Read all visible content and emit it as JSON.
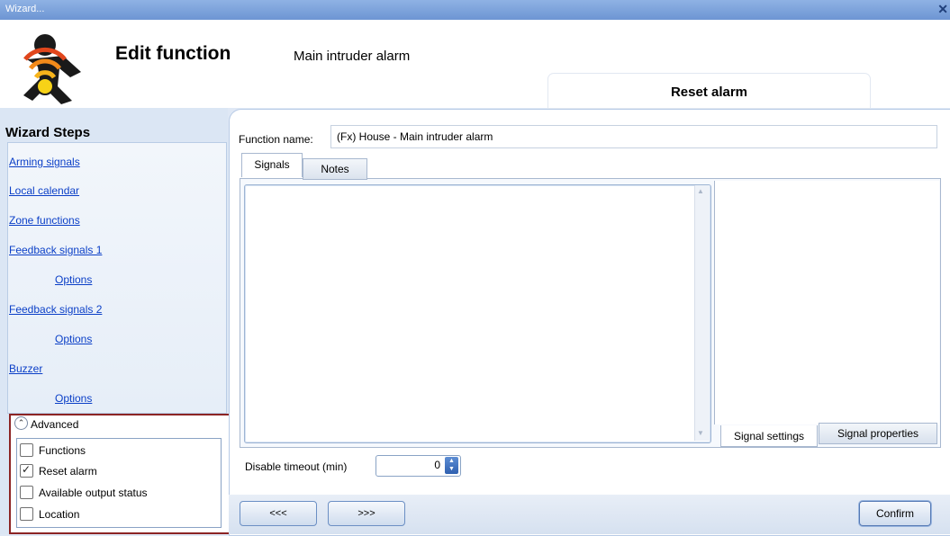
{
  "window": {
    "title": "Wizard...",
    "close_icon": "close-icon"
  },
  "header": {
    "title": "Edit function",
    "subtitle": "Main intruder alarm",
    "current_step": "Reset alarm"
  },
  "sidebar": {
    "title": "Wizard Steps",
    "steps": [
      {
        "label": "Arming signals"
      },
      {
        "label": "Local calendar"
      },
      {
        "label": "Zone functions"
      },
      {
        "label": "Feedback signals 1"
      },
      {
        "label": "Options"
      },
      {
        "label": "Feedback signals 2"
      },
      {
        "label": "Options"
      },
      {
        "label": "Buzzer"
      },
      {
        "label": "Options"
      }
    ],
    "advanced": {
      "label": "Advanced",
      "options": [
        {
          "label": "Functions",
          "checked": false
        },
        {
          "label": "Reset alarm",
          "checked": true
        },
        {
          "label": "Available output status",
          "checked": false
        },
        {
          "label": "Location",
          "checked": false
        }
      ]
    }
  },
  "main": {
    "function_name_label": "Function name:",
    "function_name_value": "(Fx) House - Main intruder alarm",
    "tabs": [
      "Signals",
      "Notes"
    ],
    "bottom_tabs": [
      "Signal settings",
      "Signal properties"
    ],
    "timeout_label": "Disable timeout (min)",
    "timeout_value": "0"
  },
  "nav": {
    "prev": "<<<",
    "next": ">>>",
    "confirm": "Confirm"
  },
  "colors": {
    "highlight_border": "#8c2424",
    "link": "#0b3fc7",
    "accent": "#6d95d3"
  }
}
